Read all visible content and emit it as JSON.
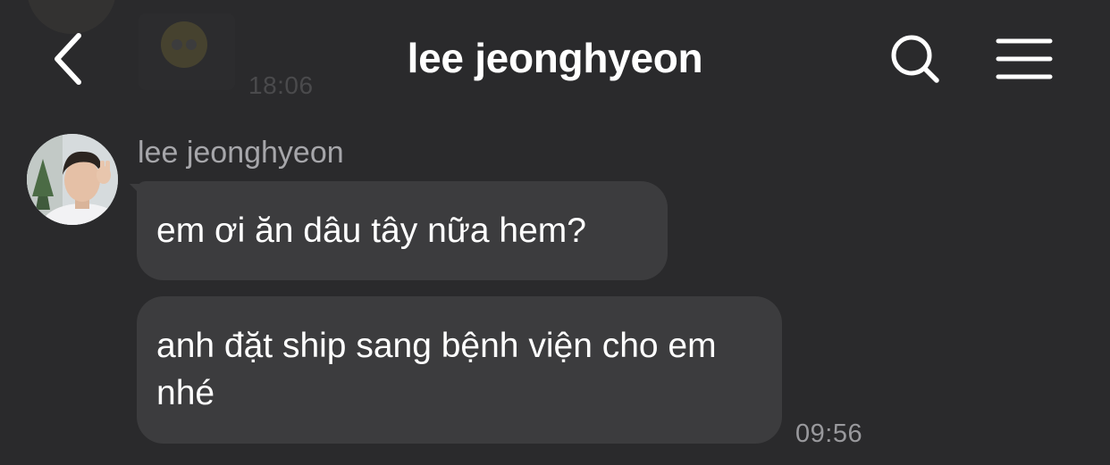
{
  "header": {
    "title": "lee jeonghyeon",
    "back_icon": "chevron-left-icon",
    "search_icon": "search-icon",
    "menu_icon": "hamburger-menu-icon"
  },
  "previous_message": {
    "time": "18:06"
  },
  "chat": {
    "sender_name": "lee jeonghyeon",
    "messages": [
      {
        "text": "em ơi ăn dâu tây nữa hem?"
      },
      {
        "text": "anh đặt ship sang bệnh viện cho em nhé"
      }
    ],
    "time": "09:56"
  },
  "colors": {
    "background": "#2a2a2c",
    "bubble": "#3c3c3e",
    "secondary_text": "#a6a6aa"
  }
}
